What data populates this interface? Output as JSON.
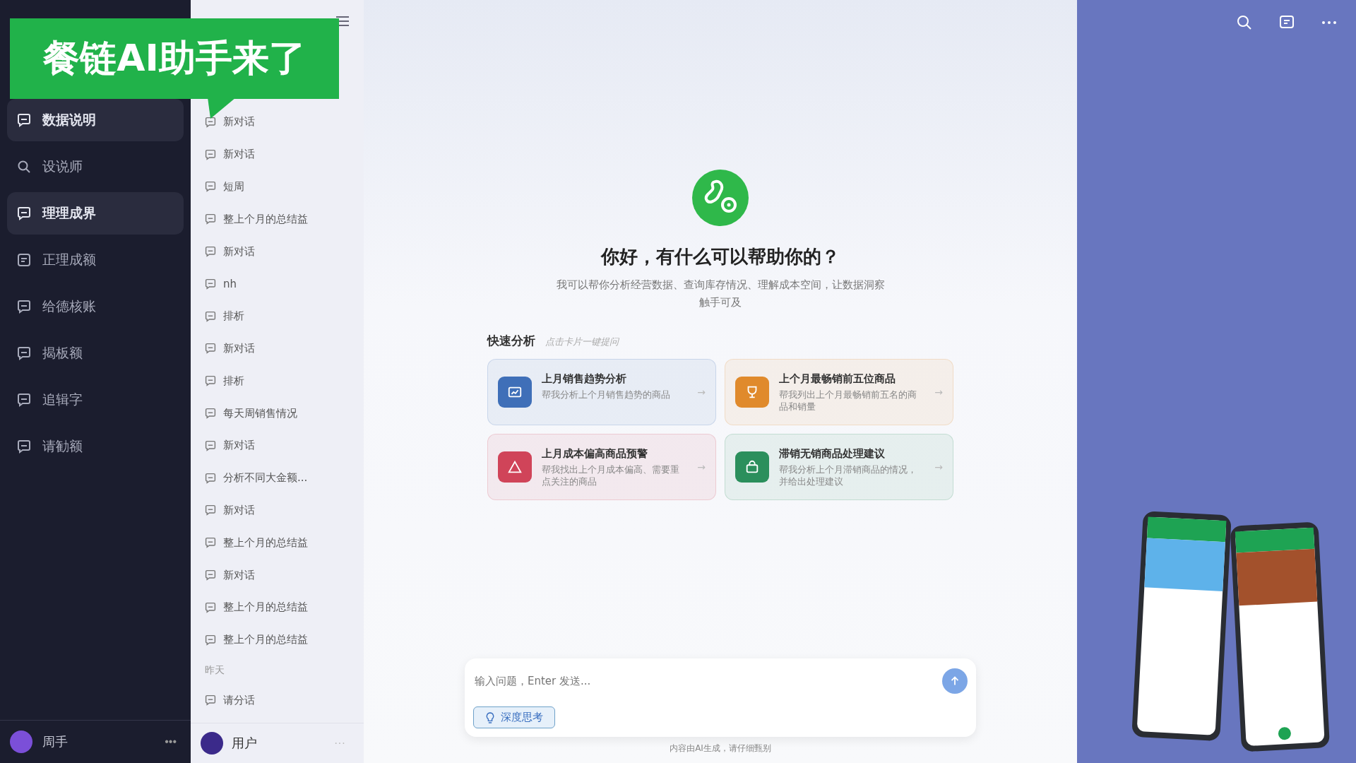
{
  "banner": {
    "text": "餐链AI助手来了"
  },
  "nav": {
    "items": [
      {
        "label": "数据说明",
        "kind": "chat",
        "selected": true
      },
      {
        "label": "设说师",
        "kind": "search",
        "selected": false
      },
      {
        "label": "理理成界",
        "kind": "chat",
        "selected": true
      },
      {
        "label": "正理成额",
        "kind": "page",
        "selected": false
      },
      {
        "label": "给德核账",
        "kind": "chat",
        "selected": false
      },
      {
        "label": "揭板额",
        "kind": "chat",
        "selected": false
      },
      {
        "label": "追辑字",
        "kind": "chat",
        "selected": false
      },
      {
        "label": "请勧额",
        "kind": "chat",
        "selected": false
      }
    ]
  },
  "nav_footer": {
    "name": "周手",
    "more": "•••"
  },
  "history": {
    "groups": [
      {
        "items": [
          "新对话",
          "新对话",
          "短周",
          "整上个月的总结益",
          "新对话",
          "nh",
          "排析",
          "新对话",
          "排析",
          "每天周销售情况",
          "新对话",
          "分析不同大金额...",
          "新对话",
          "整上个月的总结益",
          "新对话",
          "整上个月的总结益",
          "整上个月的总结益"
        ]
      },
      {
        "heading": "昨天",
        "items": [
          "请分话"
        ]
      }
    ]
  },
  "history_footer": {
    "name": "用户",
    "more": "···"
  },
  "main": {
    "greeting": "你好，有什么可以帮助你的？",
    "description": "我可以帮你分析经营数据、查询库存情况、理解成本空间，让数据洞察触手可及",
    "quick": {
      "title": "快速分析",
      "hint": "点击卡片一键提问",
      "cards": [
        {
          "kind": "chart",
          "title": "上月销售趋势分析",
          "desc": "帮我分析上个月销售趋势的商品",
          "arrow": "→",
          "color": "#3f6fb8"
        },
        {
          "kind": "trophy",
          "title": "上个月最畅销前五位商品",
          "desc": "帮我列出上个月最畅销前五名的商品和销量",
          "arrow": "→",
          "color": "#e08a2c"
        },
        {
          "kind": "warning",
          "title": "上月成本偏高商品预警",
          "desc": "帮我找出上个月成本偏高、需要重点关注的商品",
          "arrow": "→",
          "color": "#d04459"
        },
        {
          "kind": "bag",
          "title": "滞销无销商品处理建议",
          "desc": "帮我分析上个月滞销商品的情况，并给出处理建议",
          "arrow": "→",
          "color": "#2b8f5c"
        }
      ]
    },
    "input": {
      "placeholder": "输入问题，Enter 发送..."
    },
    "deep_think": {
      "label": "深度思考"
    },
    "note": "内容由AI生成，请仔细甄别"
  }
}
